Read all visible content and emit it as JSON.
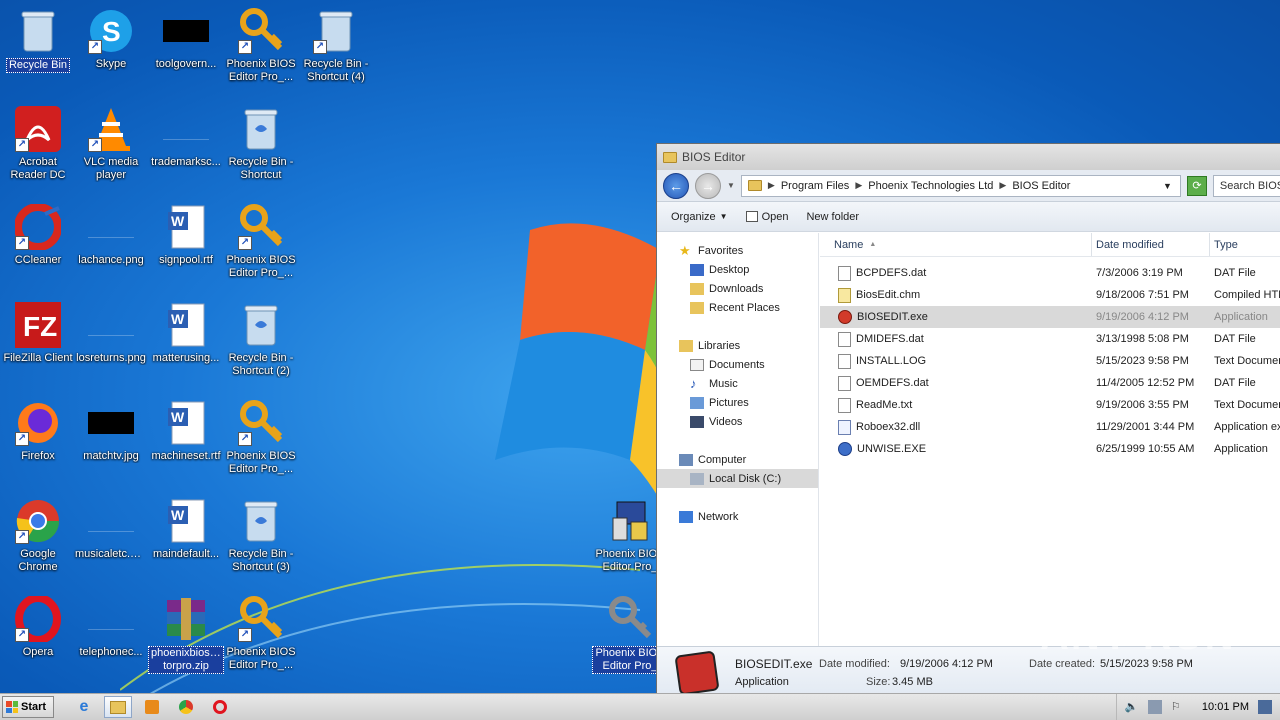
{
  "desktop": {
    "icons": [
      {
        "label": "Recycle Bin"
      },
      {
        "label": "Skype"
      },
      {
        "label": "toolgovern..."
      },
      {
        "label": "Phoenix BIOS Editor Pro_..."
      },
      {
        "label": "Recycle Bin - Shortcut (4)"
      },
      {
        "label": "Acrobat Reader DC"
      },
      {
        "label": "VLC media player"
      },
      {
        "label": "trademarksc..."
      },
      {
        "label": "Recycle Bin - Shortcut"
      },
      {
        "label": "CCleaner"
      },
      {
        "label": "lachance.png"
      },
      {
        "label": "signpool.rtf"
      },
      {
        "label": "Phoenix BIOS Editor Pro_..."
      },
      {
        "label": "FileZilla Client"
      },
      {
        "label": "losreturns.png"
      },
      {
        "label": "matterusing..."
      },
      {
        "label": "Recycle Bin - Shortcut (2)"
      },
      {
        "label": "Firefox"
      },
      {
        "label": "matchtv.jpg"
      },
      {
        "label": "machineset.rtf"
      },
      {
        "label": "Phoenix BIOS Editor Pro_..."
      },
      {
        "label": "Google Chrome"
      },
      {
        "label": "musicaletc.png"
      },
      {
        "label": "maindefault..."
      },
      {
        "label": "Recycle Bin - Shortcut (3)"
      },
      {
        "label": "Opera"
      },
      {
        "label": "telephonec..."
      },
      {
        "label": "phoenixbiosedi torpro.zip"
      },
      {
        "label": "Phoenix BIOS Editor Pro_..."
      },
      {
        "label": "Phoenix BIOS Editor Pro_"
      },
      {
        "label": "Phoenix BIOS Editor Pro_"
      }
    ]
  },
  "explorer": {
    "title": "BIOS Editor",
    "breadcrumb": [
      "Program Files",
      "Phoenix Technologies Ltd",
      "BIOS Editor"
    ],
    "search_placeholder": "Search BIOS E",
    "toolbar": {
      "organize": "Organize",
      "open": "Open",
      "new_folder": "New folder"
    },
    "nav": {
      "favorites": "Favorites",
      "desktop": "Desktop",
      "downloads": "Downloads",
      "recent": "Recent Places",
      "libraries": "Libraries",
      "documents": "Documents",
      "music": "Music",
      "pictures": "Pictures",
      "videos": "Videos",
      "computer": "Computer",
      "local_disk": "Local Disk (C:)",
      "network": "Network"
    },
    "columns": {
      "name": "Name",
      "date": "Date modified",
      "type": "Type"
    },
    "files": [
      {
        "name": "BCPDEFS.dat",
        "date": "7/3/2006 3:19 PM",
        "type": "DAT File"
      },
      {
        "name": "BiosEdit.chm",
        "date": "9/18/2006 7:51 PM",
        "type": "Compiled HTML"
      },
      {
        "name": "BIOSEDIT.exe",
        "date": "9/19/2006 4:12 PM",
        "type": "Application"
      },
      {
        "name": "DMIDEFS.dat",
        "date": "3/13/1998 5:08 PM",
        "type": "DAT File"
      },
      {
        "name": "INSTALL.LOG",
        "date": "5/15/2023 9:58 PM",
        "type": "Text Document"
      },
      {
        "name": "OEMDEFS.dat",
        "date": "11/4/2005 12:52 PM",
        "type": "DAT File"
      },
      {
        "name": "ReadMe.txt",
        "date": "9/19/2006 3:55 PM",
        "type": "Text Document"
      },
      {
        "name": "Roboex32.dll",
        "date": "11/29/2001 3:44 PM",
        "type": "Application ex"
      },
      {
        "name": "UNWISE.EXE",
        "date": "6/25/1999 10:55 AM",
        "type": "Application"
      }
    ],
    "details": {
      "name": "BIOSEDIT.exe",
      "modified_label": "Date modified:",
      "modified": "9/19/2006 4:12 PM",
      "created_label": "Date created:",
      "created": "5/15/2023 9:58 PM",
      "type": "Application",
      "size_label": "Size:",
      "size": "3.45 MB"
    }
  },
  "watermark": "ANY RUN",
  "taskbar": {
    "start": "Start",
    "time": "10:01 PM"
  }
}
